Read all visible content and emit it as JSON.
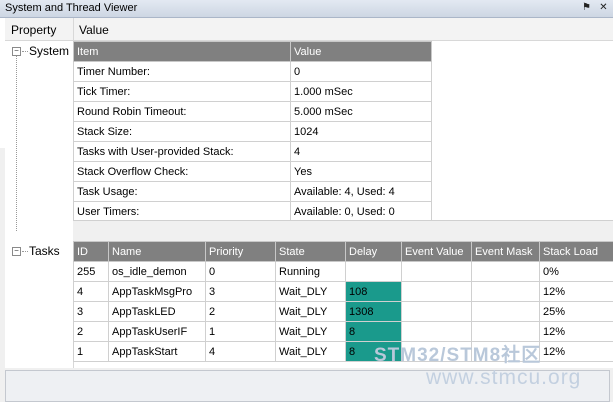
{
  "window": {
    "title": "System and Thread Viewer",
    "pin_icon": "pin-icon",
    "close_icon": "close-icon"
  },
  "columns": {
    "property": "Property",
    "value": "Value"
  },
  "tree": {
    "system_label": "System",
    "tasks_label": "Tasks"
  },
  "system_table": {
    "headers": [
      "Item",
      "Value"
    ],
    "rows": [
      [
        "Timer Number:",
        "0"
      ],
      [
        "Tick Timer:",
        "1.000 mSec"
      ],
      [
        "Round Robin Timeout:",
        "5.000 mSec"
      ],
      [
        "Stack Size:",
        "1024"
      ],
      [
        "Tasks with User-provided Stack:",
        "4"
      ],
      [
        "Stack Overflow Check:",
        "Yes"
      ],
      [
        "Task Usage:",
        "Available: 4, Used: 4"
      ],
      [
        "User Timers:",
        "Available: 0, Used: 0"
      ]
    ]
  },
  "tasks_table": {
    "headers": [
      "ID",
      "Name",
      "Priority",
      "State",
      "Delay",
      "Event Value",
      "Event Mask",
      "Stack Load"
    ],
    "rows": [
      [
        "255",
        "os_idle_demon",
        "0",
        "Running",
        "",
        "",
        "",
        "0%"
      ],
      [
        "4",
        "AppTaskMsgPro",
        "3",
        "Wait_DLY",
        "108",
        "",
        "",
        "12%"
      ],
      [
        "3",
        "AppTaskLED",
        "2",
        "Wait_DLY",
        "1308",
        "",
        "",
        "25%"
      ],
      [
        "2",
        "AppTaskUserIF",
        "1",
        "Wait_DLY",
        "8",
        "",
        "",
        "12%"
      ],
      [
        "1",
        "AppTaskStart",
        "4",
        "Wait_DLY",
        "8",
        "",
        "",
        "12%"
      ]
    ],
    "delay_highlight_color": "#1a9a8c"
  },
  "watermark": {
    "line1": "STM32/STM8社区",
    "line2": "www.stmcu.org"
  }
}
